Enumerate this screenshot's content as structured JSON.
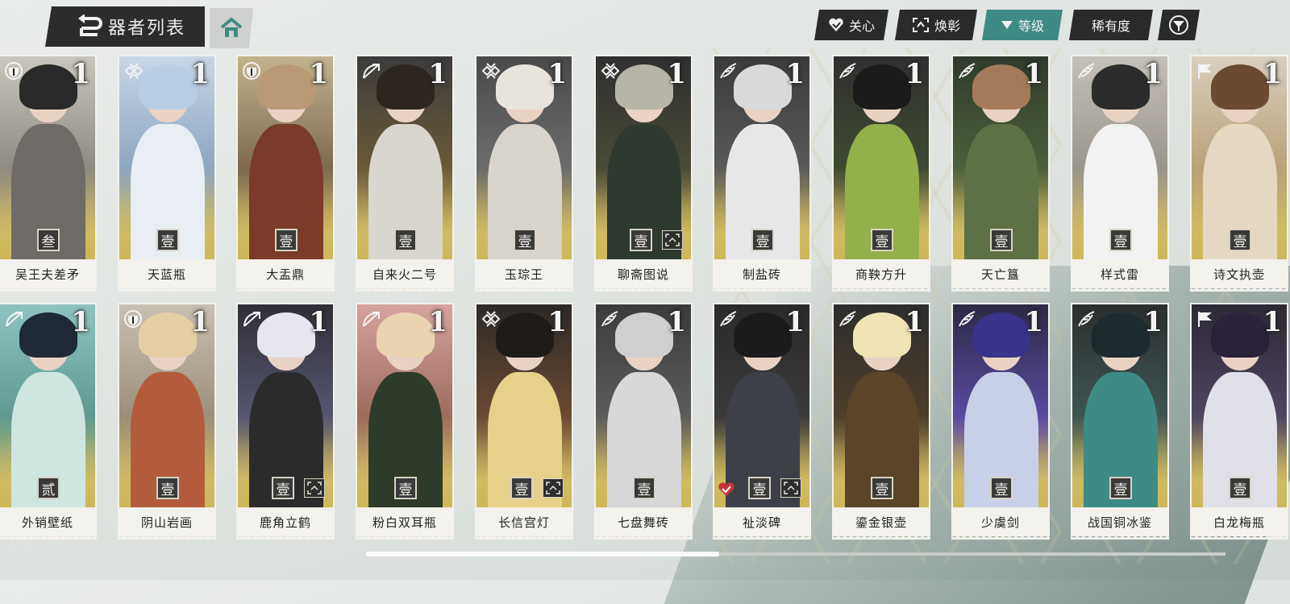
{
  "header": {
    "title": "器者列表",
    "filters": [
      {
        "label": "关心",
        "icon": "heart-icon",
        "active": false
      },
      {
        "label": "焕彰",
        "icon": "focus-frame-icon",
        "active": false
      },
      {
        "label": "等级",
        "icon": "triangle-down-icon",
        "active": true
      },
      {
        "label": "稀有度",
        "icon": "",
        "active": false
      }
    ]
  },
  "colors": {
    "accent": "#3e8b85",
    "dark": "#2a2a2c",
    "gold": "#c9b561"
  },
  "cards": [
    {
      "name": "吴王夫差矛",
      "level": "1",
      "rank": "叁",
      "type": "shield-icon",
      "eye": false,
      "heart": false
    },
    {
      "name": "天蓝瓶",
      "level": "1",
      "rank": "壹",
      "type": "knot-icon",
      "eye": false,
      "heart": false
    },
    {
      "name": "大盂鼎",
      "level": "1",
      "rank": "壹",
      "type": "shield-icon",
      "eye": false,
      "heart": false
    },
    {
      "name": "自来火二号",
      "level": "1",
      "rank": "壹",
      "type": "bow-icon",
      "eye": false,
      "heart": false
    },
    {
      "name": "玉琮王",
      "level": "1",
      "rank": "壹",
      "type": "knot-icon",
      "eye": false,
      "heart": false
    },
    {
      "name": "聊斋图说",
      "level": "1",
      "rank": "壹",
      "type": "knot-icon",
      "eye": true,
      "heart": false
    },
    {
      "name": "制盐砖",
      "level": "1",
      "rank": "壹",
      "type": "feather-icon",
      "eye": false,
      "heart": false
    },
    {
      "name": "商鞅方升",
      "level": "1",
      "rank": "壹",
      "type": "feather-icon",
      "eye": false,
      "heart": false
    },
    {
      "name": "天亡簋",
      "level": "1",
      "rank": "壹",
      "type": "feather-icon",
      "eye": false,
      "heart": false
    },
    {
      "name": "样式雷",
      "level": "1",
      "rank": "壹",
      "type": "feather-icon",
      "eye": false,
      "heart": false
    },
    {
      "name": "诗文执壶",
      "level": "1",
      "rank": "壹",
      "type": "flag-icon",
      "eye": false,
      "heart": false
    },
    {
      "name": "外销壁纸",
      "level": "1",
      "rank": "贰",
      "type": "bow-icon",
      "eye": false,
      "heart": false
    },
    {
      "name": "阴山岩画",
      "level": "1",
      "rank": "壹",
      "type": "shield-icon",
      "eye": false,
      "heart": false
    },
    {
      "name": "鹿角立鹤",
      "level": "1",
      "rank": "壹",
      "type": "bow-icon",
      "eye": true,
      "heart": false
    },
    {
      "name": "粉白双耳瓶",
      "level": "1",
      "rank": "壹",
      "type": "bow-icon",
      "eye": false,
      "heart": false
    },
    {
      "name": "长信宫灯",
      "level": "1",
      "rank": "壹",
      "type": "knot-icon",
      "eye": true,
      "heart": false
    },
    {
      "name": "七盘舞砖",
      "level": "1",
      "rank": "壹",
      "type": "feather-icon",
      "eye": false,
      "heart": false
    },
    {
      "name": "祉淡碑",
      "level": "1",
      "rank": "壹",
      "type": "feather-icon",
      "eye": true,
      "heart": true
    },
    {
      "name": "鎏金银壶",
      "level": "1",
      "rank": "壹",
      "type": "feather-icon",
      "eye": false,
      "heart": false
    },
    {
      "name": "少虞剑",
      "level": "1",
      "rank": "壹",
      "type": "feather-icon",
      "eye": false,
      "heart": false
    },
    {
      "name": "战国铜冰鉴",
      "level": "1",
      "rank": "壹",
      "type": "feather-icon",
      "eye": false,
      "heart": false
    },
    {
      "name": "白龙梅瓶",
      "level": "1",
      "rank": "壹",
      "type": "flag-icon",
      "eye": false,
      "heart": false
    }
  ]
}
